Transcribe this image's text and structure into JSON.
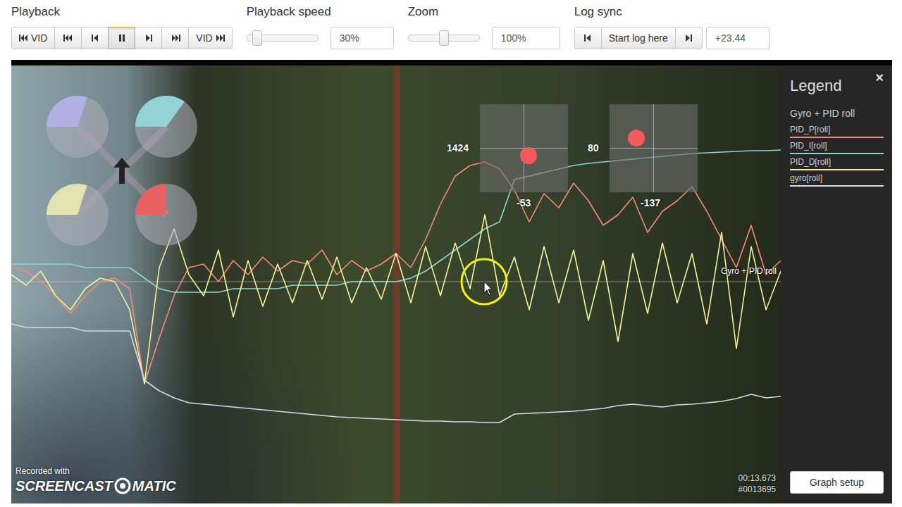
{
  "playback": {
    "label": "Playback",
    "buttons": [
      {
        "kind": "video-start",
        "label": "VID",
        "selected": false
      },
      {
        "kind": "start",
        "selected": false
      },
      {
        "kind": "step-back",
        "selected": false
      },
      {
        "kind": "pause",
        "selected": true
      },
      {
        "kind": "step-forward",
        "selected": false
      },
      {
        "kind": "end",
        "selected": false
      },
      {
        "kind": "video-end",
        "label": "VID",
        "selected": false
      }
    ]
  },
  "speed": {
    "label": "Playback speed",
    "level": 0.15,
    "value": "30%"
  },
  "zoom": {
    "label": "Zoom",
    "level": 0.5,
    "value": "100%"
  },
  "log_sync": {
    "label": "Log sync",
    "buttons": [
      {
        "kind": "step-back",
        "selected": false
      },
      {
        "kind": "text",
        "label": "Start log here",
        "selected": false
      },
      {
        "kind": "step-forward",
        "selected": false
      }
    ],
    "value": "+23.44"
  },
  "motors": [
    {
      "level": 0.3,
      "color": "#b3b0e6"
    },
    {
      "level": 0.35,
      "color": "#93d3d6"
    },
    {
      "level": 0.3,
      "color": "#e3e3b0"
    },
    {
      "level": 0.25,
      "color": "#e86060"
    }
  ],
  "sticks": [
    {
      "x_label": "1424",
      "y_label": "-53",
      "level_x": 0.55,
      "level_y": 0.58
    },
    {
      "x_label": "80",
      "y_label": "-137",
      "level_x": 0.3,
      "level_y": 0.38
    }
  ],
  "chart": {
    "title": "Gyro + PID roll",
    "series": [
      {
        "name": "PID_P[roll]",
        "color": "#f58a7a",
        "values": [
          20,
          15,
          0,
          -20,
          -45,
          -20,
          0,
          5,
          -10,
          -145,
          -80,
          -20,
          20,
          25,
          0,
          30,
          10,
          35,
          15,
          30,
          25,
          45,
          10,
          30,
          15,
          25,
          40,
          20,
          60,
          110,
          150,
          165,
          170,
          160,
          130,
          85,
          125,
          105,
          140,
          115,
          80,
          95,
          120,
          70,
          100,
          115,
          135,
          100,
          60,
          20,
          80,
          10,
          30
        ]
      },
      {
        "name": "PID_I[roll]",
        "color": "#8fd6cf",
        "values": [
          25,
          25,
          25,
          25,
          25,
          20,
          20,
          20,
          20,
          5,
          -10,
          -15,
          -15,
          -15,
          -15,
          -10,
          -10,
          -10,
          -10,
          -5,
          -5,
          -5,
          -5,
          0,
          0,
          0,
          0,
          5,
          15,
          30,
          45,
          60,
          75,
          85,
          145,
          150,
          155,
          160,
          165,
          168,
          170,
          172,
          174,
          176,
          178,
          180,
          182,
          183,
          184,
          185,
          186,
          186,
          187
        ]
      },
      {
        "name": "PID_D[roll]",
        "color": "#f5f09a",
        "values": [
          10,
          -5,
          15,
          -20,
          -40,
          -10,
          5,
          0,
          -40,
          -145,
          20,
          75,
          10,
          -20,
          45,
          -50,
          30,
          -35,
          25,
          -30,
          30,
          -25,
          35,
          -30,
          20,
          -25,
          40,
          -30,
          50,
          -20,
          55,
          -10,
          95,
          -20,
          35,
          -40,
          50,
          -30,
          45,
          -55,
          30,
          -85,
          40,
          -45,
          55,
          -30,
          40,
          -60,
          70,
          -95,
          50,
          -40,
          15
        ]
      },
      {
        "name": "gyro[roll]",
        "color": "#d8d8e6",
        "values": [
          -60,
          -65,
          -65,
          -65,
          -65,
          -70,
          -70,
          -70,
          -70,
          -140,
          -155,
          -165,
          -172,
          -174,
          -176,
          -178,
          -180,
          -182,
          -184,
          -186,
          -188,
          -190,
          -192,
          -193,
          -194,
          -195,
          -196,
          -197,
          -198,
          -198,
          -199,
          -199,
          -200,
          -200,
          -188,
          -187,
          -186,
          -185,
          -184,
          -182,
          -180,
          -176,
          -174,
          -176,
          -178,
          -175,
          -174,
          -172,
          -170,
          -166,
          -160,
          -165,
          -163
        ]
      }
    ]
  },
  "legend": {
    "title": "Legend",
    "close": "×",
    "button": "Graph setup"
  },
  "overlay": {
    "time": "00:13.673",
    "frame": "#0013695"
  },
  "watermark": {
    "caption": "Recorded with",
    "brand_left": "SCREENCAST",
    "brand_right": "MATIC"
  }
}
